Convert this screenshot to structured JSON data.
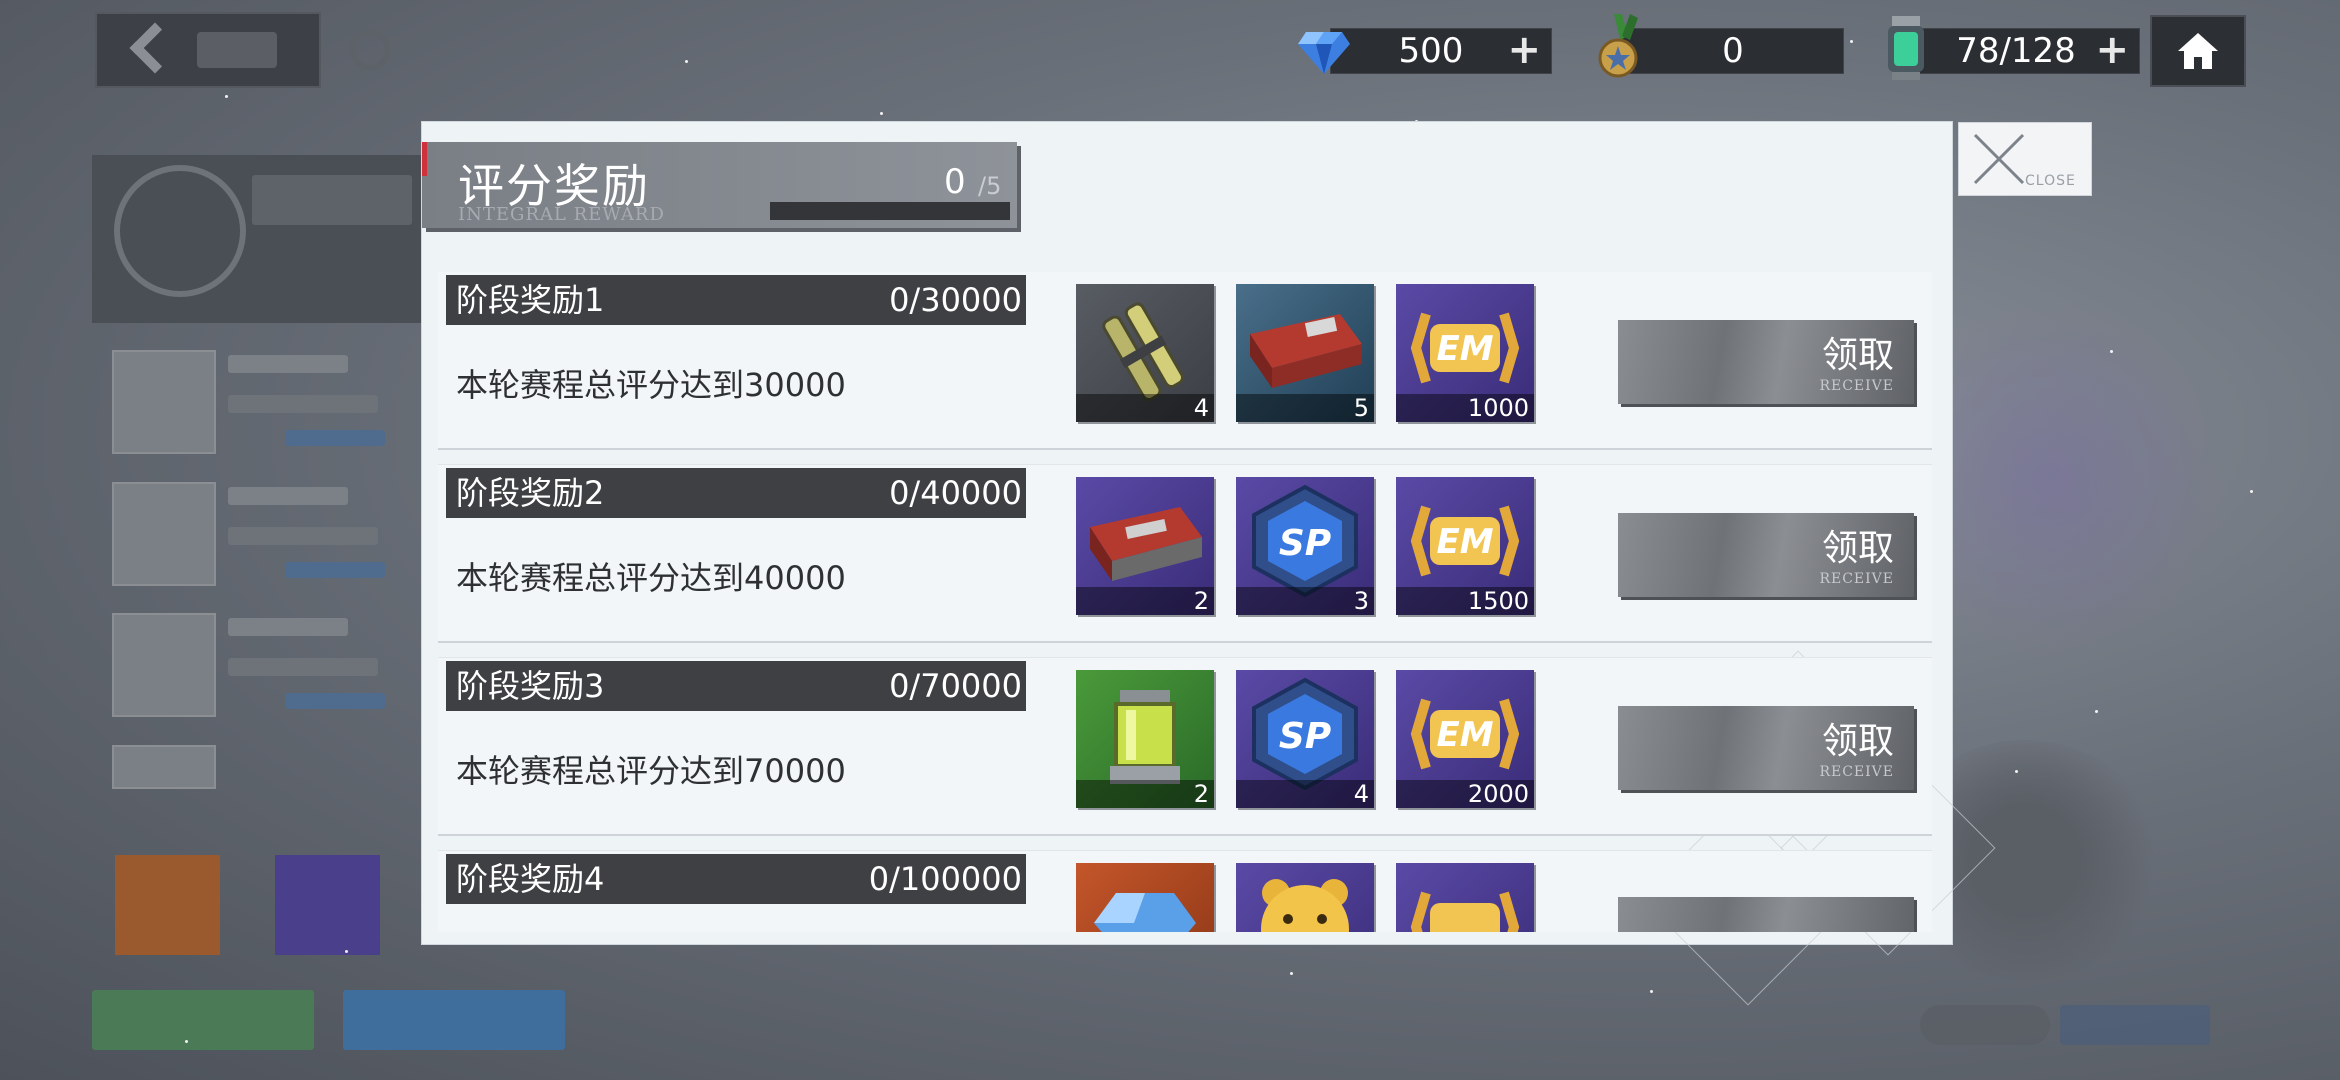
{
  "resources": [
    {
      "name": "diamond",
      "value": "500",
      "has_plus": true
    },
    {
      "name": "medal",
      "value": "0",
      "has_plus": false
    },
    {
      "name": "stamina",
      "value": "78/128",
      "has_plus": true
    }
  ],
  "modal": {
    "title": "评分奖励",
    "subtitle": "INTEGRAL REWARD",
    "score_current": "0",
    "score_total": "/5",
    "close_label": "CLOSE"
  },
  "rewards": [
    {
      "name": "阶段奖励1",
      "progress": "0/30000",
      "desc": "本轮赛程总评分达到30000",
      "items": [
        {
          "icon": "battery-cells-icon",
          "qty": "4"
        },
        {
          "icon": "red-crate-icon",
          "qty": "5"
        },
        {
          "icon": "em-badge-icon",
          "qty": "1000"
        }
      ],
      "claim_label": "领取",
      "claim_sub": "RECEIVE"
    },
    {
      "name": "阶段奖励2",
      "progress": "0/40000",
      "desc": "本轮赛程总评分达到40000",
      "items": [
        {
          "icon": "red-crate-icon",
          "qty": "2"
        },
        {
          "icon": "sp-badge-icon",
          "qty": "3"
        },
        {
          "icon": "em-badge-icon",
          "qty": "1500"
        }
      ],
      "claim_label": "领取",
      "claim_sub": "RECEIVE"
    },
    {
      "name": "阶段奖励3",
      "progress": "0/70000",
      "desc": "本轮赛程总评分达到70000",
      "items": [
        {
          "icon": "energy-canister-icon",
          "qty": "2"
        },
        {
          "icon": "sp-badge-icon",
          "qty": "4"
        },
        {
          "icon": "em-badge-icon",
          "qty": "2000"
        }
      ],
      "claim_label": "领取",
      "claim_sub": "RECEIVE"
    },
    {
      "name": "阶段奖励4",
      "progress": "0/100000",
      "desc": "",
      "items": [
        {
          "icon": "crystal-icon",
          "qty": ""
        },
        {
          "icon": "bear-icon",
          "qty": ""
        },
        {
          "icon": "em-badge-icon",
          "qty": ""
        }
      ],
      "claim_label": "",
      "claim_sub": ""
    }
  ],
  "colors": {
    "accent_red": "#d0303a",
    "row_head": "#3e4043",
    "modal_bg": "#eef3f6"
  }
}
